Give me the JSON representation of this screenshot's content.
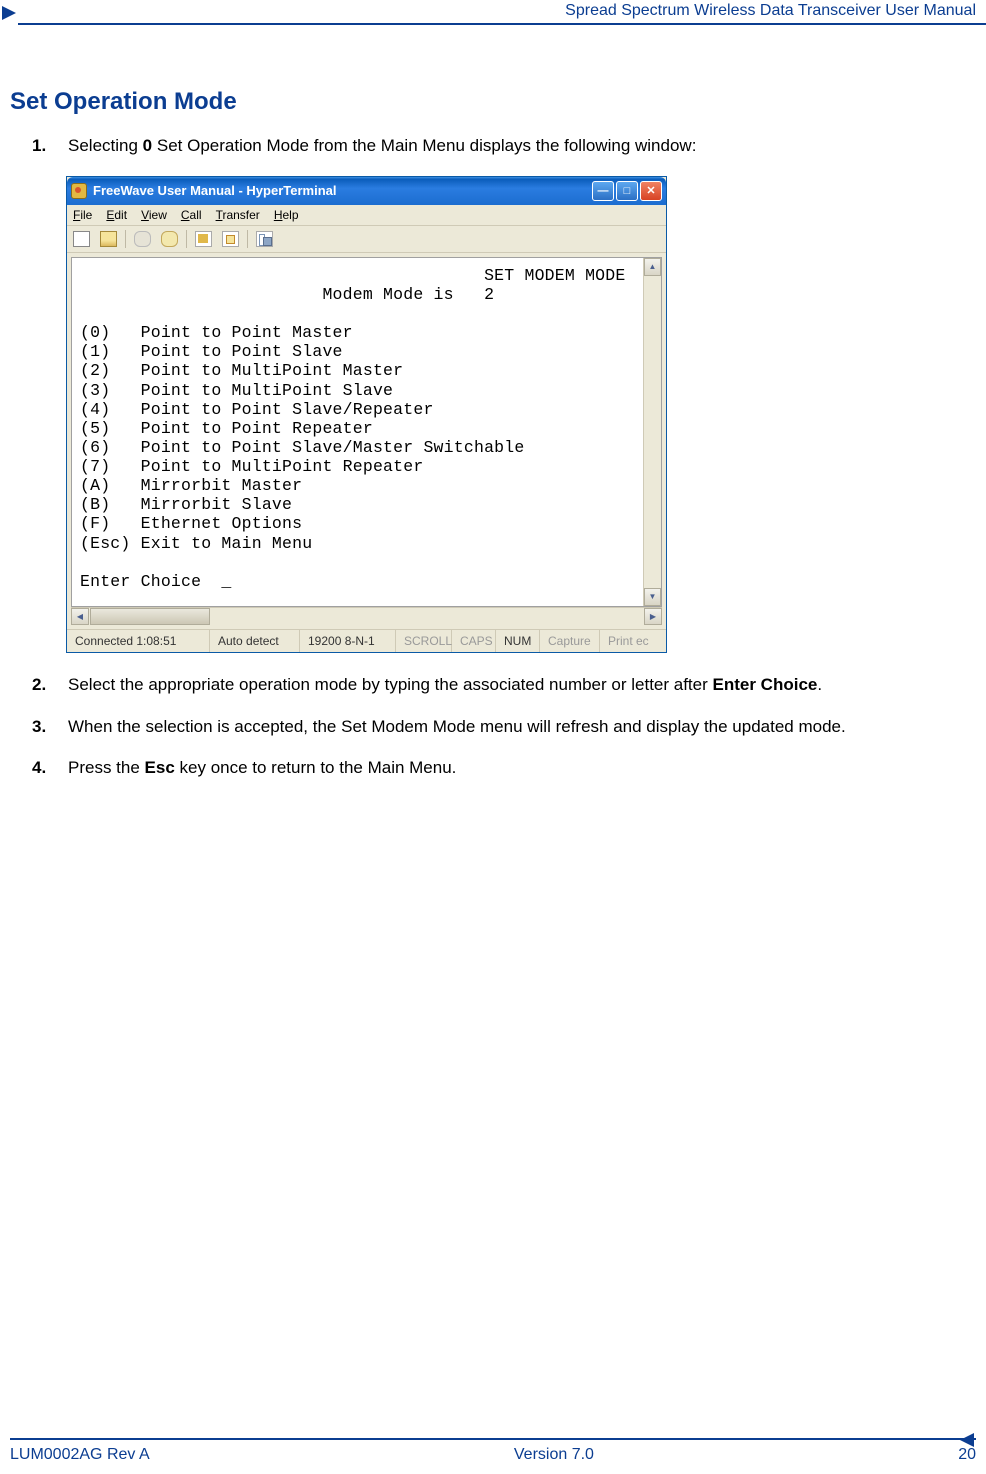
{
  "header": {
    "doc_title": "Spread Spectrum Wireless Data Transceiver User Manual"
  },
  "section": {
    "heading": "Set Operation Mode",
    "step1_pre": "Selecting ",
    "step1_bold": "0",
    "step1_post": " Set Operation Mode from the Main Menu displays the following window:",
    "step2_pre": "Select the appropriate operation mode by typing the associated number or letter after ",
    "step2_bold": "Enter Choice",
    "step2_post": ".",
    "step3": "When the selection is accepted, the Set Modem Mode menu will refresh and display the updated mode.",
    "step4_pre": "Press the ",
    "step4_bold": "Esc",
    "step4_post": " key once to return to the Main Menu."
  },
  "window": {
    "title": "FreeWave User Manual - HyperTerminal",
    "menu": {
      "file": "File",
      "edit": "Edit",
      "view": "View",
      "call": "Call",
      "transfer": "Transfer",
      "help": "Help"
    },
    "terminal": {
      "header_line": "                                        SET MODEM MODE",
      "status_line": "                        Modem Mode is   2",
      "options": [
        "(0)   Point to Point Master",
        "(1)   Point to Point Slave",
        "(2)   Point to MultiPoint Master",
        "(3)   Point to MultiPoint Slave",
        "(4)   Point to Point Slave/Repeater",
        "(5)   Point to Point Repeater",
        "(6)   Point to Point Slave/Master Switchable",
        "(7)   Point to MultiPoint Repeater",
        "(A)   Mirrorbit Master",
        "(B)   Mirrorbit Slave",
        "(F)   Ethernet Options",
        "(Esc) Exit to Main Menu"
      ],
      "prompt": "Enter Choice  _"
    },
    "status": {
      "conn": "Connected 1:08:51",
      "detect": "Auto detect",
      "baud": "19200 8-N-1",
      "scroll": "SCROLL",
      "caps": "CAPS",
      "num": "NUM",
      "capture": "Capture",
      "print": "Print ec"
    }
  },
  "footer": {
    "left": "LUM0002AG Rev A",
    "center": "Version 7.0",
    "right": "20"
  }
}
